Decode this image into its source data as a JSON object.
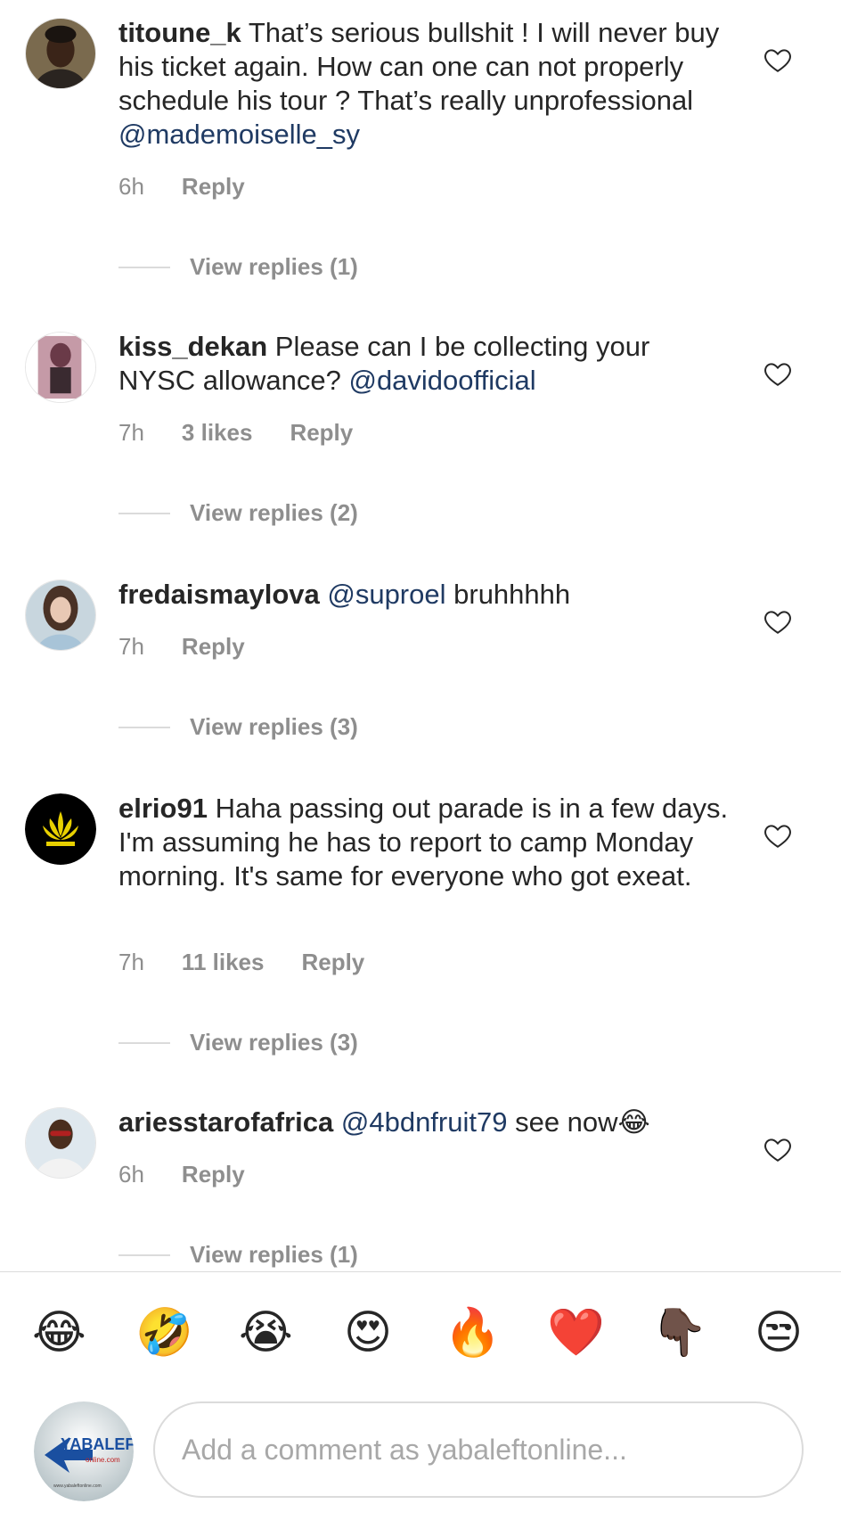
{
  "comments": [
    {
      "username": "titoune_k",
      "text": "That’s serious bullshit ! I will never buy his ticket again. How can one can not properly schedule his tour ? That’s really unprofessional ",
      "mention": "@mademoiselle_sy",
      "text_after": "",
      "time": "6h",
      "likes": "",
      "reply_label": "Reply",
      "view_replies": "View replies (1)"
    },
    {
      "username": "kiss_dekan",
      "text": "Please can I be collecting your NYSC allowance? ",
      "mention": "@davidoofficial",
      "text_after": "",
      "time": "7h",
      "likes": "3 likes",
      "reply_label": "Reply",
      "view_replies": "View replies (2)"
    },
    {
      "username": "fredaismaylova",
      "text": "",
      "mention": "@suproel",
      "text_after": " bruhhhhh",
      "time": "7h",
      "likes": "",
      "reply_label": "Reply",
      "view_replies": "View replies (3)"
    },
    {
      "username": "elrio91",
      "text": "Haha passing out parade is in a few days. I'm assuming he has to report to camp Monday morning. It's same for everyone who got exeat.",
      "mention": "",
      "text_after": "",
      "time": "7h",
      "likes": "11 likes",
      "reply_label": "Reply",
      "view_replies": "View replies (3)"
    },
    {
      "username": "ariesstarofafrica",
      "text": "",
      "mention": "@4bdnfruit79",
      "text_after": " see now😂",
      "time": "6h",
      "likes": "",
      "reply_label": "Reply",
      "view_replies": "View replies (1)"
    }
  ],
  "emojis": [
    "😂",
    "🤣",
    "😭",
    "😍",
    "🔥",
    "❤️",
    "👇🏿",
    "😒"
  ],
  "composer": {
    "placeholder": "Add a comment as yabaleftonline...",
    "avatar_logo": "YABALEFT",
    "avatar_logo_sub": "online.com",
    "avatar_url_text": "www.yabaleftonline.com"
  },
  "colors": {
    "mention": "#1f3a63",
    "meta": "#8e8e8e",
    "divider": "#dbdbdb"
  },
  "icons": [
    "heart-outline-icon"
  ]
}
